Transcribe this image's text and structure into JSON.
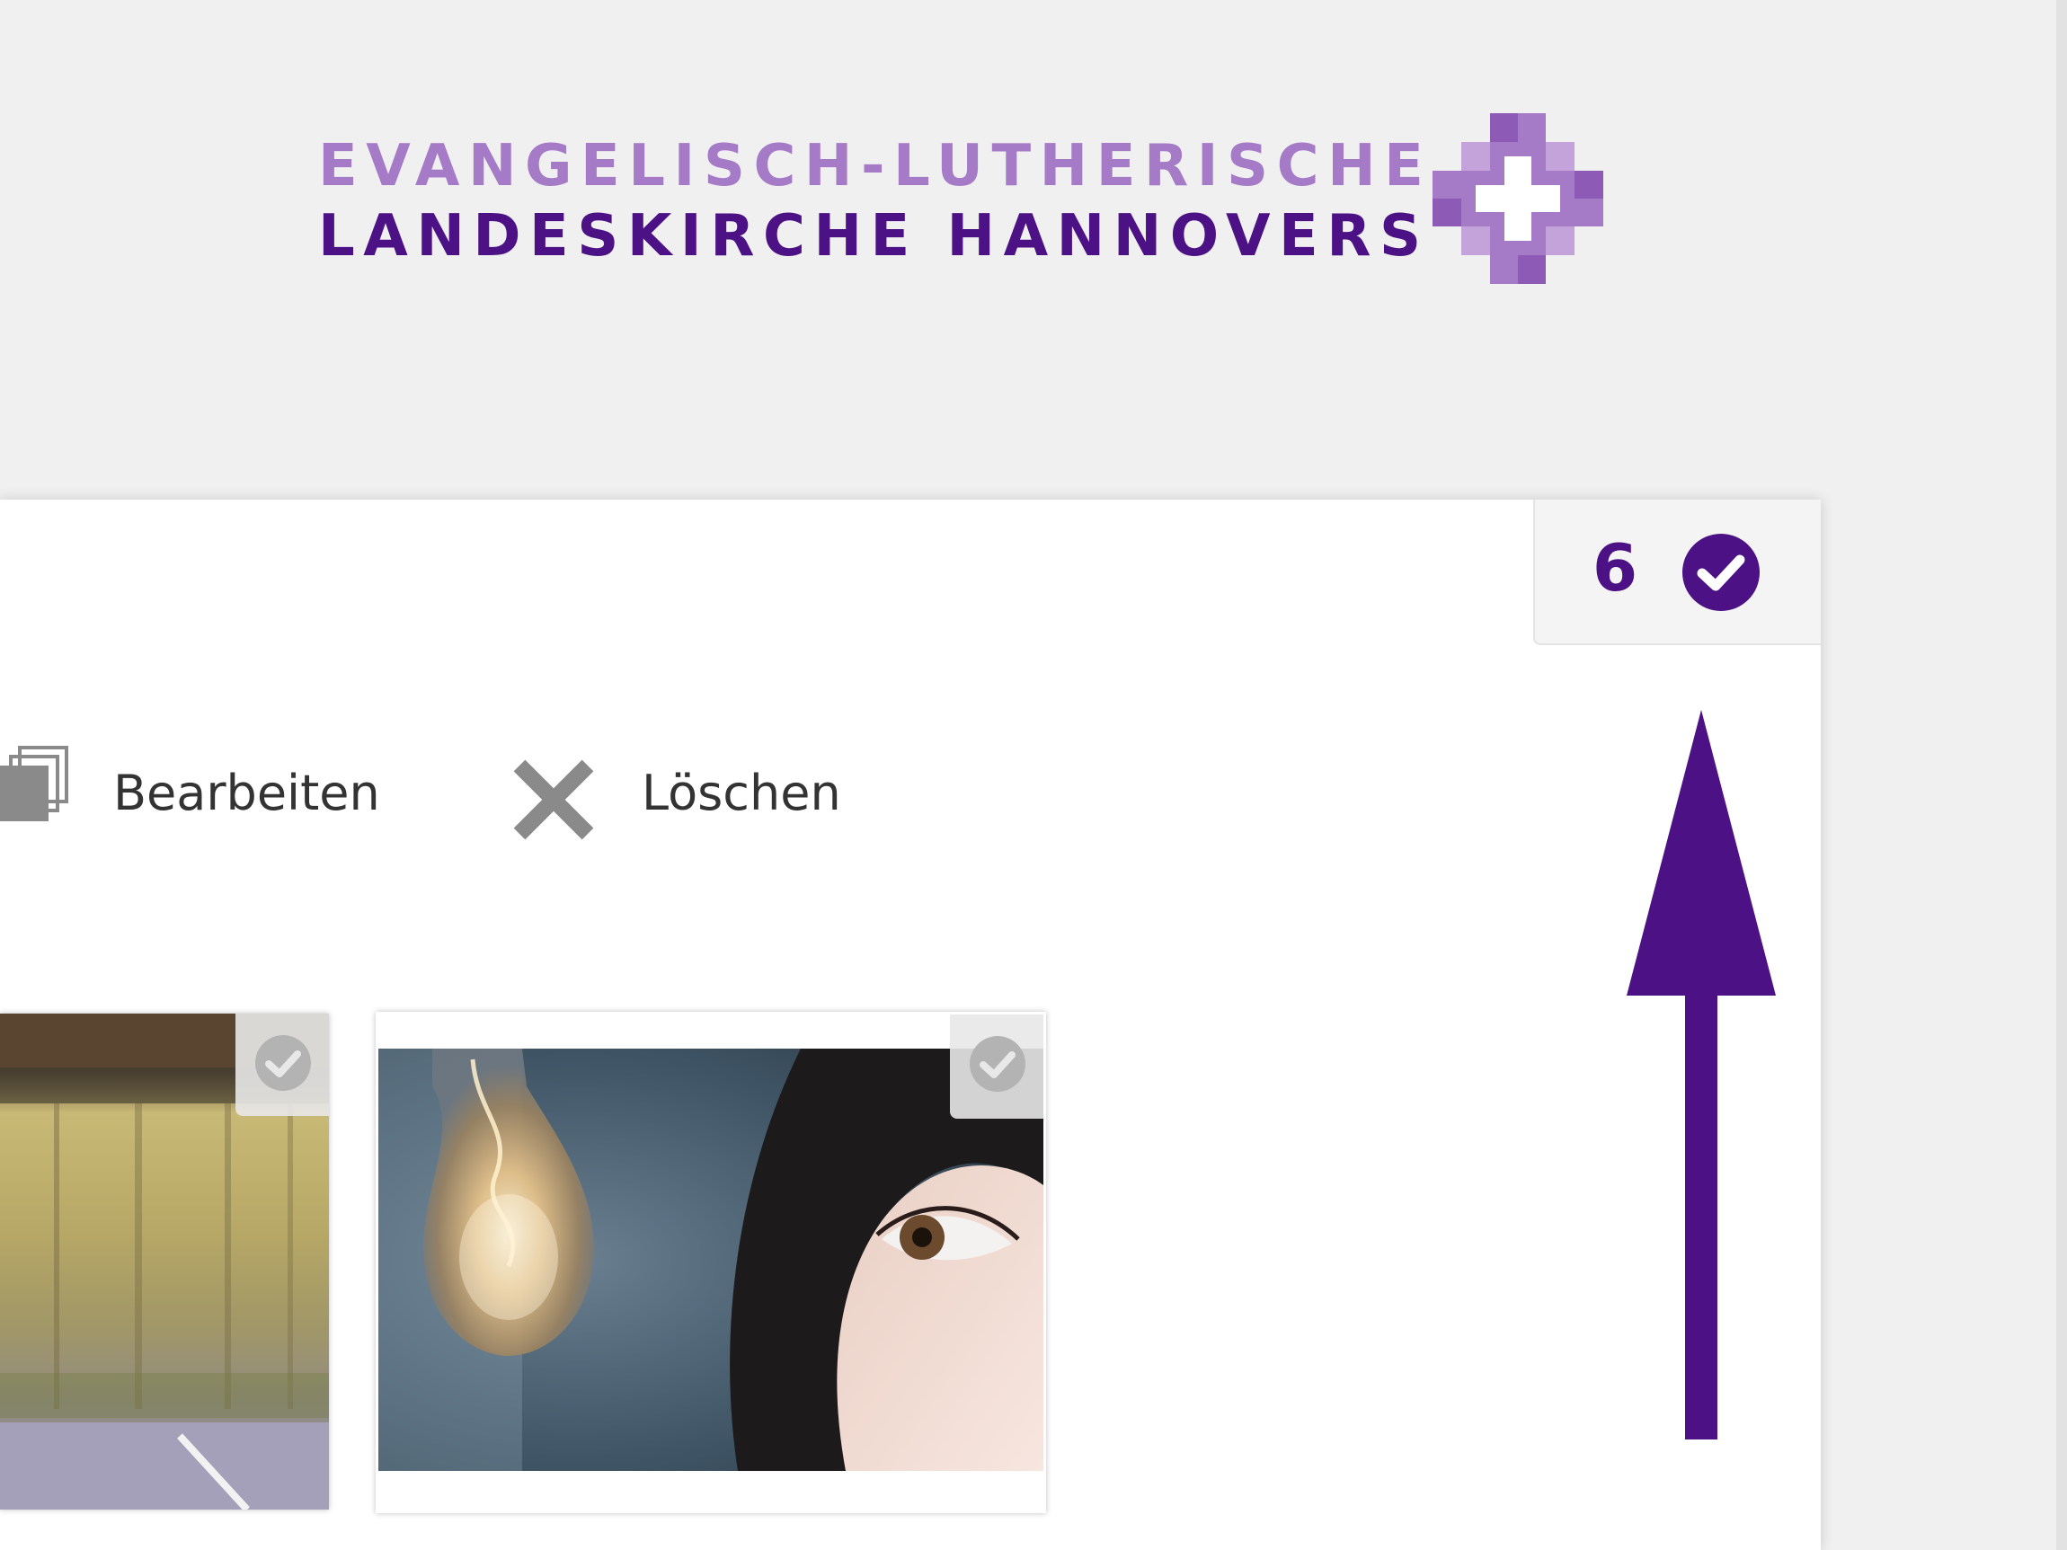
{
  "logo": {
    "line1": "EVANGELISCH-LUTHERISCHE",
    "line2": "LANDESKIRCHE HANNOVERS",
    "icon": "cross-logo-icon"
  },
  "selection": {
    "count": "6",
    "icon": "check-circle-icon"
  },
  "toolbar": {
    "edit_label": "Bearbeiten",
    "edit_icon": "stacked-images-icon",
    "delete_label": "Löschen",
    "delete_icon": "close-x-icon"
  },
  "thumbnails": [
    {
      "subject": "weathered wall",
      "selected": false,
      "icon": "check-circle-icon"
    },
    {
      "subject": "light bulb and eye",
      "selected": false,
      "icon": "check-circle-icon"
    }
  ],
  "annotation": {
    "icon": "up-arrow-icon"
  },
  "colors": {
    "brand_dark": "#4b1185",
    "brand_light": "#a57ac7",
    "background": "#f0f0f0",
    "panel": "#ffffff",
    "icon_gray": "#8a8a8a"
  }
}
